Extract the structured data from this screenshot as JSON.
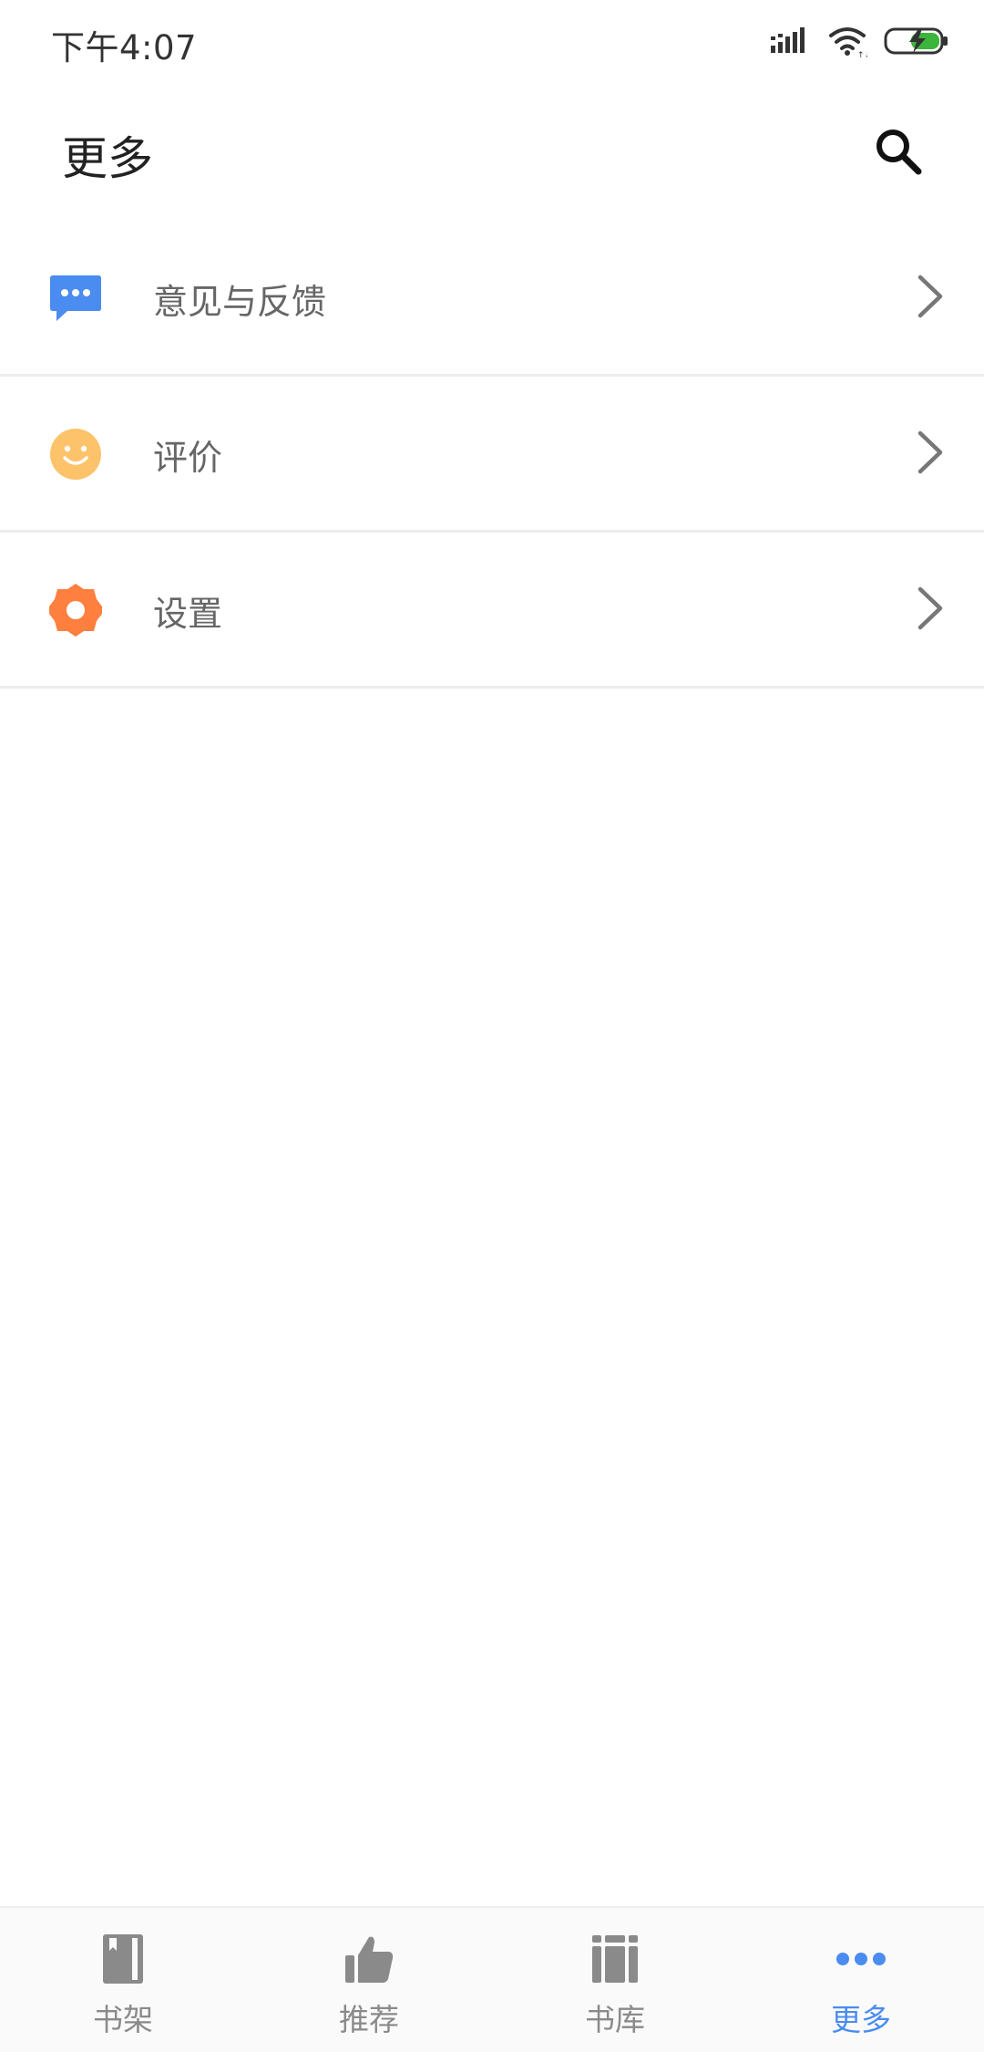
{
  "status_bar": {
    "time": "下午4:07",
    "icons": [
      "signal-icon",
      "wifi-icon",
      "battery-charging-icon"
    ]
  },
  "header": {
    "title": "更多",
    "search_icon": "search-icon"
  },
  "menu": {
    "items": [
      {
        "label": "意见与反馈",
        "icon": "feedback-chat-icon",
        "icon_color": "#4a8cf0"
      },
      {
        "label": "评价",
        "icon": "smiley-icon",
        "icon_color": "#fdc36a"
      },
      {
        "label": "设置",
        "icon": "gear-icon",
        "icon_color": "#ff7f3f"
      }
    ]
  },
  "tab_bar": {
    "active_color": "#4a8cf0",
    "inactive_color": "#8a8a8a",
    "tabs": [
      {
        "label": "书架",
        "icon": "bookshelf-icon"
      },
      {
        "label": "推荐",
        "icon": "thumbs-up-icon"
      },
      {
        "label": "书库",
        "icon": "library-icon"
      },
      {
        "label": "更多",
        "icon": "more-dots-icon",
        "active": true
      }
    ]
  }
}
